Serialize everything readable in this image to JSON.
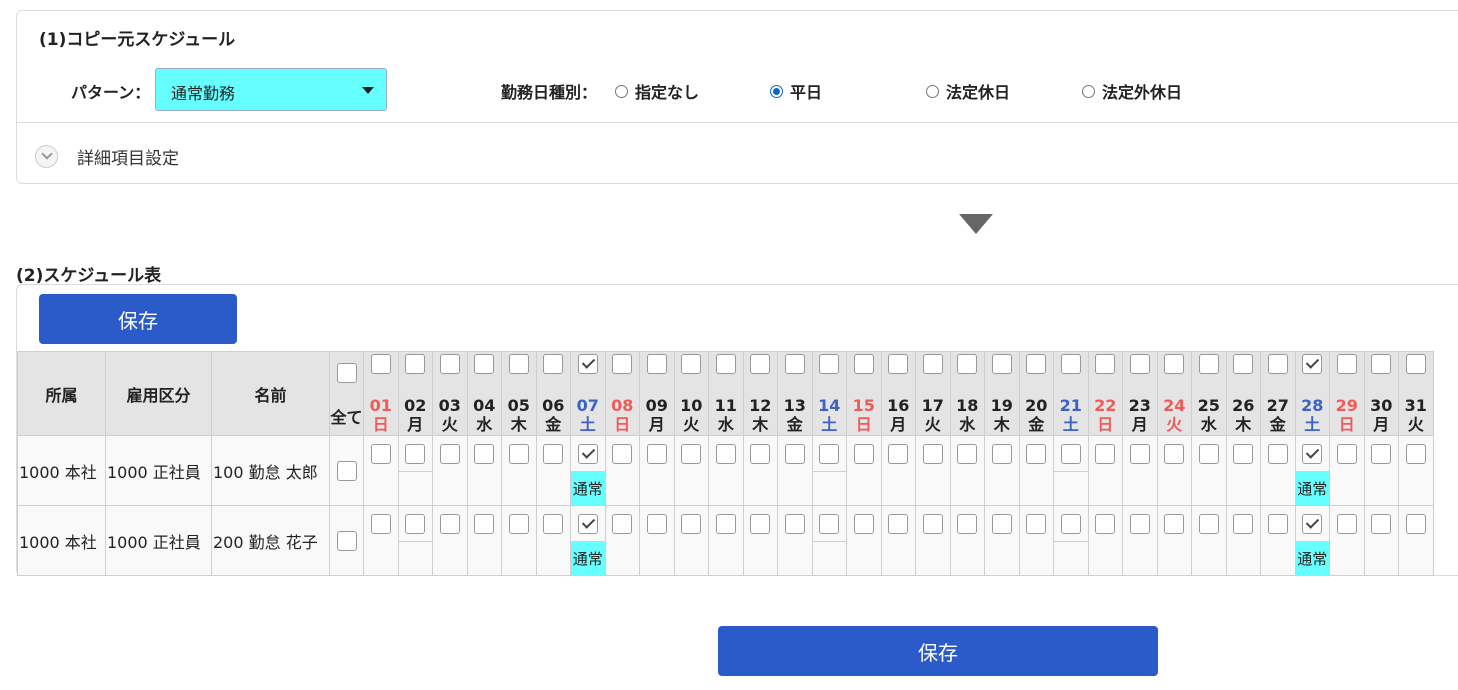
{
  "copy_source": {
    "title": "(1)コピー元スケジュール",
    "pattern_label": "パターン：",
    "pattern_value": "通常勤務",
    "worktype_label": "勤務日種別：",
    "worktype_options": [
      "指定なし",
      "平日",
      "法定休日",
      "法定外休日"
    ],
    "worktype_selected": "平日",
    "detail_label": "詳細項目設定"
  },
  "schedule": {
    "title": "(2)スケジュール表",
    "save_label": "保存",
    "headers": {
      "affiliation": "所属",
      "employment": "雇用区分",
      "name": "名前",
      "all": "全て"
    },
    "days": [
      {
        "num": "01",
        "wk": "日",
        "color": "red",
        "checked": false
      },
      {
        "num": "02",
        "wk": "月",
        "color": "",
        "checked": false
      },
      {
        "num": "03",
        "wk": "火",
        "color": "",
        "checked": false
      },
      {
        "num": "04",
        "wk": "水",
        "color": "",
        "checked": false
      },
      {
        "num": "05",
        "wk": "木",
        "color": "",
        "checked": false
      },
      {
        "num": "06",
        "wk": "金",
        "color": "",
        "checked": false
      },
      {
        "num": "07",
        "wk": "土",
        "color": "blue",
        "checked": true
      },
      {
        "num": "08",
        "wk": "日",
        "color": "red",
        "checked": false
      },
      {
        "num": "09",
        "wk": "月",
        "color": "",
        "checked": false
      },
      {
        "num": "10",
        "wk": "火",
        "color": "",
        "checked": false
      },
      {
        "num": "11",
        "wk": "水",
        "color": "",
        "checked": false
      },
      {
        "num": "12",
        "wk": "木",
        "color": "",
        "checked": false
      },
      {
        "num": "13",
        "wk": "金",
        "color": "",
        "checked": false
      },
      {
        "num": "14",
        "wk": "土",
        "color": "blue",
        "checked": false
      },
      {
        "num": "15",
        "wk": "日",
        "color": "red",
        "checked": false
      },
      {
        "num": "16",
        "wk": "月",
        "color": "",
        "checked": false
      },
      {
        "num": "17",
        "wk": "火",
        "color": "",
        "checked": false
      },
      {
        "num": "18",
        "wk": "水",
        "color": "",
        "checked": false
      },
      {
        "num": "19",
        "wk": "木",
        "color": "",
        "checked": false
      },
      {
        "num": "20",
        "wk": "金",
        "color": "",
        "checked": false
      },
      {
        "num": "21",
        "wk": "土",
        "color": "blue",
        "checked": false
      },
      {
        "num": "22",
        "wk": "日",
        "color": "red",
        "checked": false
      },
      {
        "num": "23",
        "wk": "月",
        "color": "",
        "checked": false
      },
      {
        "num": "24",
        "wk": "火",
        "color": "red",
        "checked": false
      },
      {
        "num": "25",
        "wk": "水",
        "color": "",
        "checked": false
      },
      {
        "num": "26",
        "wk": "木",
        "color": "",
        "checked": false
      },
      {
        "num": "27",
        "wk": "金",
        "color": "",
        "checked": false
      },
      {
        "num": "28",
        "wk": "土",
        "color": "blue",
        "checked": true
      },
      {
        "num": "29",
        "wk": "日",
        "color": "red",
        "checked": false
      },
      {
        "num": "30",
        "wk": "月",
        "color": "",
        "checked": false
      },
      {
        "num": "31",
        "wk": "火",
        "color": "",
        "checked": false
      }
    ],
    "rows": [
      {
        "affiliation": "1000 本社",
        "employment": "1000 正社員",
        "name": "100 勤怠 太郎",
        "checked_days": [
          "07",
          "28"
        ],
        "badge": "通常",
        "split_days": [
          "02",
          "14",
          "21"
        ]
      },
      {
        "affiliation": "1000 本社",
        "employment": "1000 正社員",
        "name": "200 勤怠 花子",
        "checked_days": [
          "07",
          "28"
        ],
        "badge": "通常",
        "split_days": [
          "02",
          "14",
          "21"
        ]
      }
    ]
  },
  "colors": {
    "accent": "#2a5bc9",
    "pattern_bg": "#66ffff",
    "sat": "#3d62c4",
    "sun": "#f25a5a"
  }
}
